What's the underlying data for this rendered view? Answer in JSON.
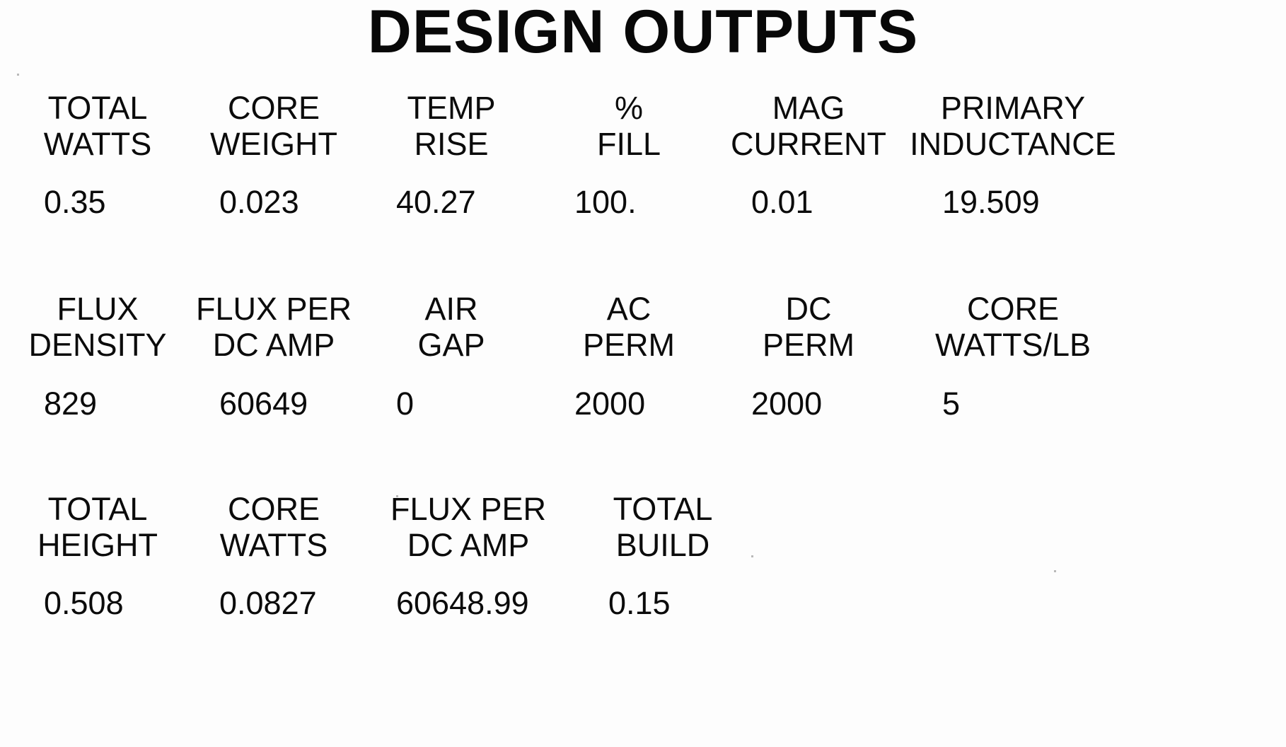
{
  "document": {
    "title": "DESIGN OUTPUTS"
  },
  "blocks": [
    {
      "id": "block-1",
      "columns": [
        {
          "header_line1": "TOTAL",
          "header_line2": "WATTS",
          "value": "0.35"
        },
        {
          "header_line1": "CORE",
          "header_line2": "WEIGHT",
          "value": "0.023"
        },
        {
          "header_line1": "TEMP",
          "header_line2": "RISE",
          "value": "40.27"
        },
        {
          "header_line1": "%",
          "header_line2": "FILL",
          "value": "100."
        },
        {
          "header_line1": "MAG",
          "header_line2": "CURRENT",
          "value": "0.01"
        },
        {
          "header_line1": "PRIMARY",
          "header_line2": "INDUCTANCE",
          "value": "19.509"
        }
      ]
    },
    {
      "id": "block-2",
      "columns": [
        {
          "header_line1": "FLUX",
          "header_line2": "DENSITY",
          "value": "829"
        },
        {
          "header_line1": "FLUX PER",
          "header_line2": "DC AMP",
          "value": "60649"
        },
        {
          "header_line1": "AIR",
          "header_line2": "GAP",
          "value": "0"
        },
        {
          "header_line1": "AC",
          "header_line2": "PERM",
          "value": "2000"
        },
        {
          "header_line1": "DC",
          "header_line2": "PERM",
          "value": "2000"
        },
        {
          "header_line1": "CORE",
          "header_line2": "WATTS/LB",
          "value": "5"
        }
      ]
    },
    {
      "id": "block-3",
      "columns": [
        {
          "header_line1": "TOTAL",
          "header_line2": "HEIGHT",
          "value": "0.508"
        },
        {
          "header_line1": "CORE",
          "header_line2": "WATTS",
          "value": "0.0827"
        },
        {
          "header_line1": "FLUX PER",
          "header_line2": "DC AMP",
          "value": "60648.99"
        },
        {
          "header_line1": "TOTAL",
          "header_line2": "BUILD",
          "value": "0.15"
        }
      ]
    }
  ]
}
